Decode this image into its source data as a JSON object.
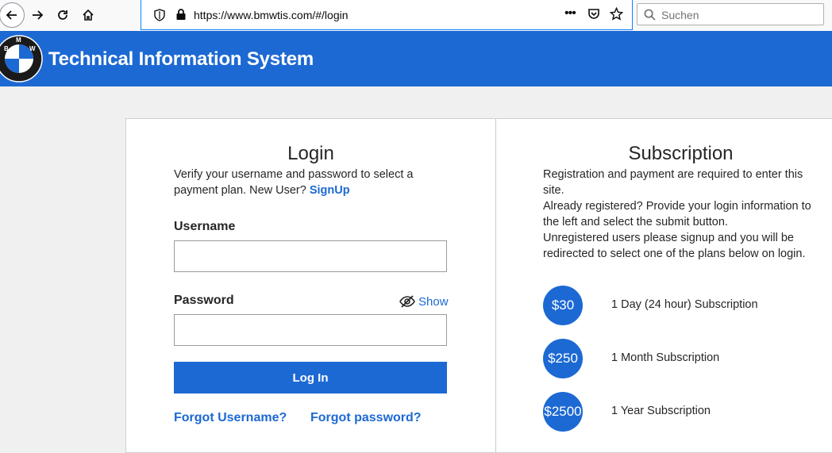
{
  "browser": {
    "url": "https://www.bmwtis.com/#/login",
    "search_placeholder": "Suchen"
  },
  "header": {
    "title": "Technical Information System",
    "logo_letters": "BMW"
  },
  "login": {
    "title": "Login",
    "description": "Verify your username and password to select a payment plan. New User?",
    "signup_label": "SignUp",
    "username_label": "Username",
    "username_value": "",
    "password_label": "Password",
    "password_value": "",
    "show_label": "Show",
    "submit_label": "Log In",
    "forgot_username": "Forgot Username?",
    "forgot_password": "Forgot password?"
  },
  "subscription": {
    "title": "Subscription",
    "lines": [
      "Registration and payment are required to enter this site.",
      "Already registered? Provide your login information to the left and select the submit button.",
      "Unregistered users please signup and you will be redirected to select one of the plans below on login."
    ],
    "plans": [
      {
        "price": "$30",
        "label": "1 Day (24 hour) Subscription"
      },
      {
        "price": "$250",
        "label": "1 Month Subscription"
      },
      {
        "price": "$2500",
        "label": "1 Year Subscription"
      }
    ]
  },
  "colors": {
    "brand_blue": "#1c69d3",
    "page_bg": "#f0f0f0"
  }
}
